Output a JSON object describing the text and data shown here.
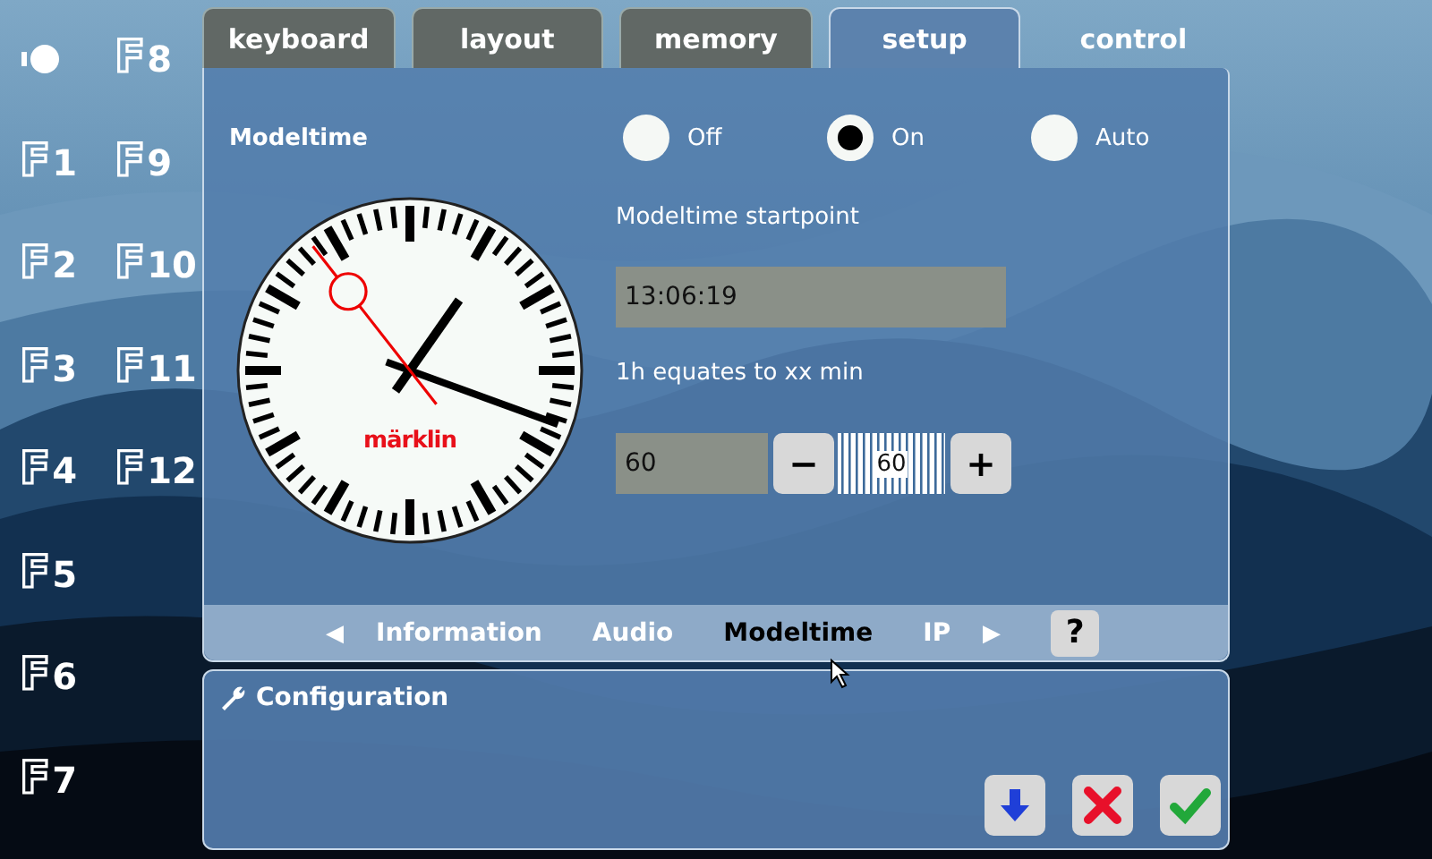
{
  "function_keys": [
    {
      "kind": "light"
    },
    {
      "kind": "function",
      "label": "F1"
    },
    {
      "kind": "function",
      "label": "F2"
    },
    {
      "kind": "function",
      "label": "F3"
    },
    {
      "kind": "function",
      "label": "F4"
    },
    {
      "kind": "function",
      "label": "F5"
    },
    {
      "kind": "function",
      "label": "F6"
    },
    {
      "kind": "function",
      "label": "F7"
    },
    {
      "kind": "function",
      "label": "F8"
    },
    {
      "kind": "function",
      "label": "F9"
    },
    {
      "kind": "function",
      "label": "F10"
    },
    {
      "kind": "function",
      "label": "F11"
    },
    {
      "kind": "function",
      "label": "F12"
    }
  ],
  "tabs": [
    {
      "label": "keyboard",
      "selected": false,
      "kind": "framed"
    },
    {
      "label": "layout",
      "selected": false,
      "kind": "framed"
    },
    {
      "label": "memory",
      "selected": false,
      "kind": "framed"
    },
    {
      "label": "setup",
      "selected": true,
      "kind": "framed"
    },
    {
      "label": "control",
      "selected": false,
      "kind": "plain"
    }
  ],
  "modeltime": {
    "title": "Modeltime",
    "modes": [
      {
        "label": "Off",
        "selected": false
      },
      {
        "label": "On",
        "selected": true
      },
      {
        "label": "Auto",
        "selected": false
      }
    ],
    "clock_brand": "märklin",
    "startpoint_label": "Modeltime startpoint",
    "startpoint_value": "13:06:19",
    "ratio_label": "1h equates to xx min",
    "ratio_value": "60",
    "minus": "−",
    "wheel_value": "60",
    "plus": "+"
  },
  "subtabs": {
    "prev": "◀",
    "next": "▶",
    "help": "?",
    "items": [
      {
        "label": "Information",
        "selected": false
      },
      {
        "label": "Audio",
        "selected": false
      },
      {
        "label": "Modeltime",
        "selected": true
      },
      {
        "label": "IP",
        "selected": false
      }
    ]
  },
  "configuration": {
    "title": "Configuration"
  }
}
